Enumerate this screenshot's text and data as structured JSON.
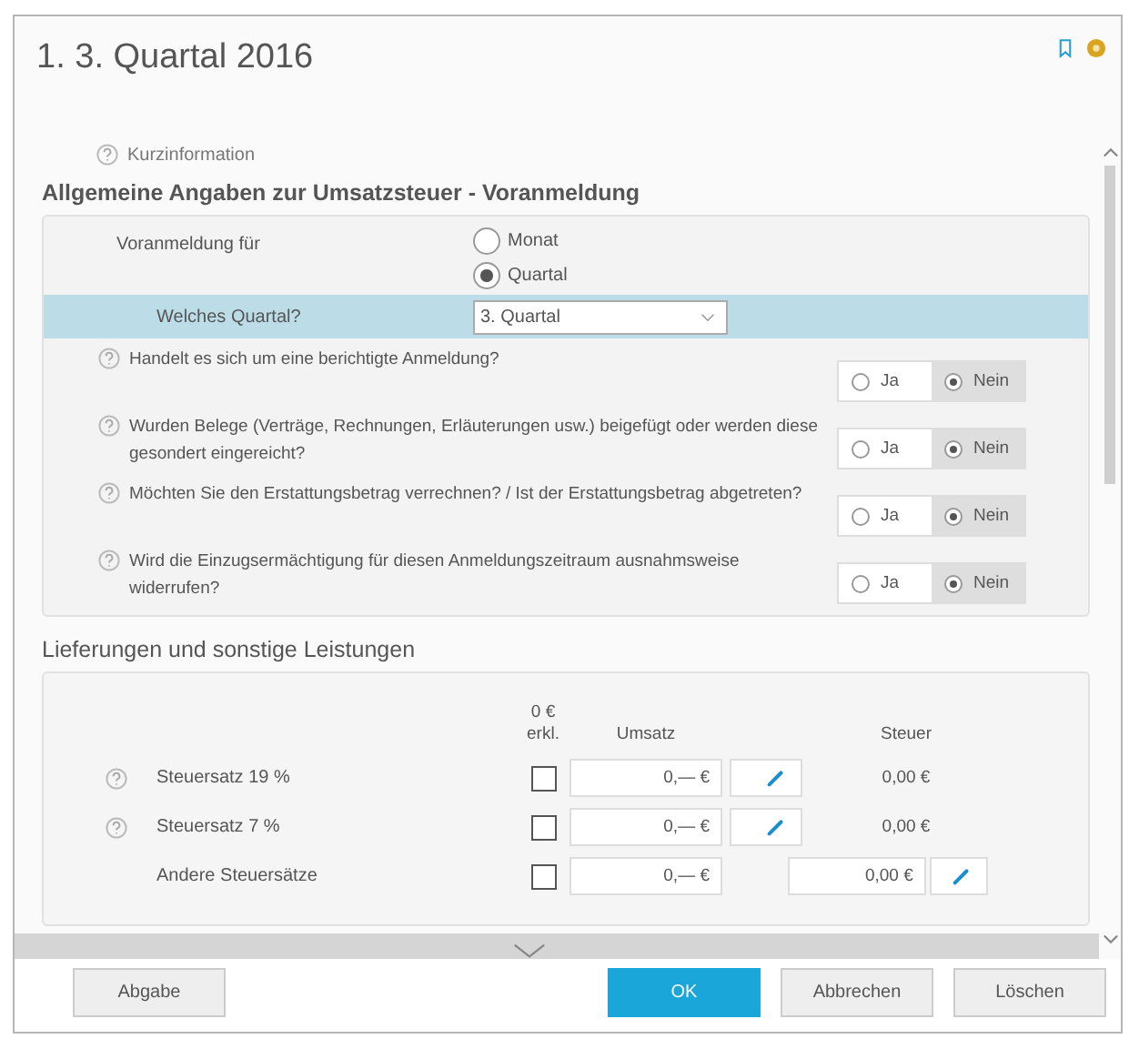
{
  "window": {
    "title": "1. 3. Quartal 2016"
  },
  "info_link": "Kurzinformation",
  "general": {
    "heading": "Allgemeine Angaben zur Umsatzsteuer - Voranmeldung",
    "period": {
      "label": "Voranmeldung für",
      "options": [
        {
          "label": "Monat",
          "selected": false
        },
        {
          "label": "Quartal",
          "selected": true
        }
      ]
    },
    "quarter": {
      "label": "Welches Quartal?",
      "value": "3. Quartal"
    },
    "questions": [
      {
        "text": "Handelt es sich um eine berichtigte Anmeldung?",
        "options": [
          {
            "label": "Ja",
            "selected": false
          },
          {
            "label": "Nein",
            "selected": true
          }
        ]
      },
      {
        "text": "Wurden Belege (Verträge, Rechnungen, Erläuterungen usw.) beigefügt oder werden diese gesondert eingereicht?",
        "options": [
          {
            "label": "Ja",
            "selected": false
          },
          {
            "label": "Nein",
            "selected": true
          }
        ]
      },
      {
        "text": "Möchten Sie den Erstattungsbetrag verrechnen? / Ist der Erstattungsbetrag abgetreten?",
        "options": [
          {
            "label": "Ja",
            "selected": false
          },
          {
            "label": "Nein",
            "selected": true
          }
        ]
      },
      {
        "text": "Wird die Einzugsermächtigung für diesen Anmeldungszeitraum ausnahmsweise widerrufen?",
        "options": [
          {
            "label": "Ja",
            "selected": false
          },
          {
            "label": "Nein",
            "selected": true
          }
        ]
      }
    ]
  },
  "deliveries": {
    "heading": "Lieferungen und sonstige Leistungen",
    "columns": {
      "zero_declared": "0 € erkl.",
      "revenue": "Umsatz",
      "tax": "Steuer"
    },
    "rows": [
      {
        "kind": "computed",
        "label": "Steuersatz 19 %",
        "checked": false,
        "revenue": "0,— €",
        "tax": "0,00 €"
      },
      {
        "kind": "computed",
        "label": "Steuersatz 7 %",
        "checked": false,
        "revenue": "0,— €",
        "tax": "0,00 €"
      },
      {
        "kind": "manual",
        "label": "Andere Steuersätze",
        "checked": false,
        "revenue": "0,— €",
        "tax": "0,00 €"
      }
    ]
  },
  "buttons": [
    {
      "label": "Abgabe",
      "kind": "normal"
    },
    {
      "label": "OK",
      "kind": "primary"
    },
    {
      "label": "Abbrechen",
      "kind": "normal"
    },
    {
      "label": "Löschen",
      "kind": "normal"
    }
  ]
}
